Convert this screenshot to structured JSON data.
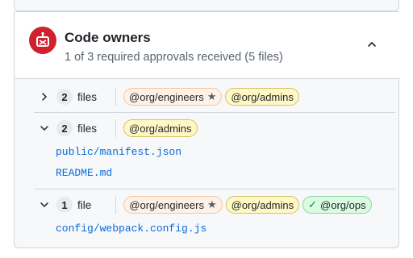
{
  "header": {
    "title": "Code owners",
    "subtitle": "1 of 3 required approvals received (5 files)",
    "status_icon": "code-owners-blocked-icon",
    "status_color": "#cf222e"
  },
  "groups": [
    {
      "expanded": false,
      "count": "2",
      "files_word": "files",
      "owners": [
        {
          "label": "@org/engineers",
          "style": "orange",
          "starred": true,
          "approved": false
        },
        {
          "label": "@org/admins",
          "style": "yellow",
          "starred": false,
          "approved": false
        }
      ],
      "files": []
    },
    {
      "expanded": true,
      "count": "2",
      "files_word": "files",
      "owners": [
        {
          "label": "@org/admins",
          "style": "yellow",
          "starred": false,
          "approved": false
        }
      ],
      "files": [
        "public/manifest.json",
        "README.md"
      ]
    },
    {
      "expanded": true,
      "count": "1",
      "files_word": "file",
      "owners": [
        {
          "label": "@org/engineers",
          "style": "orange",
          "starred": true,
          "approved": false
        },
        {
          "label": "@org/admins",
          "style": "yellow",
          "starred": false,
          "approved": false
        },
        {
          "label": "@org/ops",
          "style": "green",
          "starred": false,
          "approved": true
        }
      ],
      "files": [
        "config/webpack.config.js"
      ]
    }
  ],
  "colors": {
    "link": "#0969da",
    "approved": "#1a7f37"
  }
}
